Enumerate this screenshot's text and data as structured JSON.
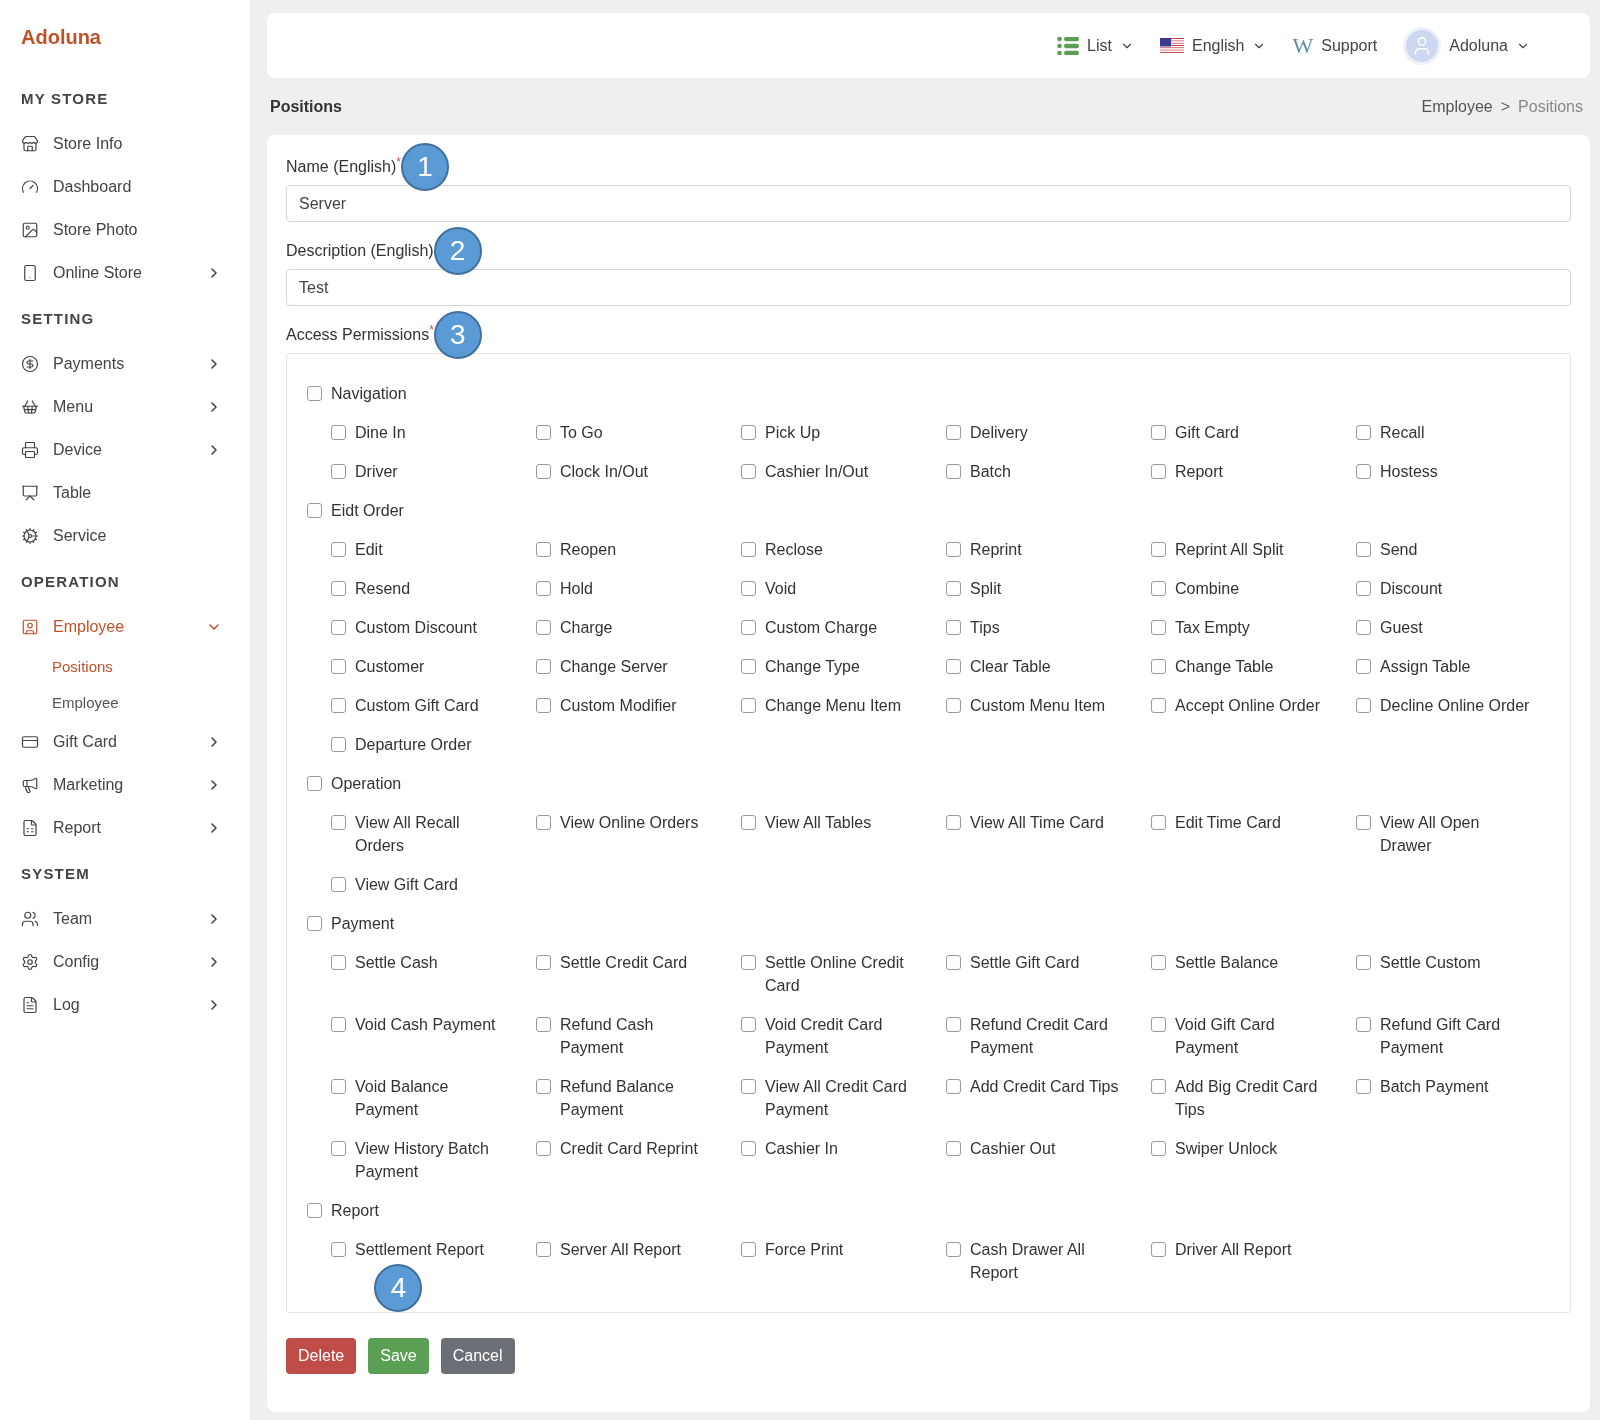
{
  "sidebar": {
    "brand": "Adoluna",
    "sections": [
      {
        "title": "MY STORE",
        "items": [
          {
            "label": "Store Info",
            "selected": false
          },
          {
            "label": "Dashboard",
            "selected": false
          },
          {
            "label": "Store Photo",
            "selected": false
          },
          {
            "label": "Online Store",
            "selected": false,
            "expanded": false
          }
        ]
      },
      {
        "title": "SETTING",
        "items": [
          {
            "label": "Payments",
            "selected": false,
            "expanded": false
          },
          {
            "label": "Menu",
            "selected": false,
            "expanded": false
          },
          {
            "label": "Device",
            "selected": false,
            "expanded": false
          },
          {
            "label": "Table",
            "selected": false
          },
          {
            "label": "Service",
            "selected": false
          }
        ]
      },
      {
        "title": "OPERATION",
        "items": [
          {
            "label": "Employee",
            "selected": true,
            "expanded": true,
            "children": [
              {
                "label": "Positions",
                "selected": true
              },
              {
                "label": "Employee",
                "selected": false
              }
            ]
          },
          {
            "label": "Gift Card",
            "selected": false,
            "expanded": false
          },
          {
            "label": "Marketing",
            "selected": false,
            "expanded": false
          },
          {
            "label": "Report",
            "selected": false,
            "expanded": false
          }
        ]
      },
      {
        "title": "SYSTEM",
        "items": [
          {
            "label": "Team",
            "selected": false,
            "expanded": false
          },
          {
            "label": "Config",
            "selected": false,
            "expanded": false
          },
          {
            "label": "Log",
            "selected": false,
            "expanded": false
          }
        ]
      }
    ]
  },
  "header": {
    "list": "List",
    "language": "English",
    "support_mark": "W",
    "support": "Support",
    "user": "Adoluna"
  },
  "page": {
    "title": "Positions",
    "breadcrumb": [
      "Employee",
      "Positions"
    ],
    "breadcrumb_separator": ">"
  },
  "form": {
    "fields": [
      {
        "label": "Name (English)",
        "required_mark": "*",
        "value": "Server",
        "callout": "1"
      },
      {
        "label": "Description (English)",
        "value": "Test",
        "callout": "2"
      }
    ],
    "permissions": {
      "label": "Access Permissions",
      "required_mark": "*",
      "callout": "3",
      "groups": [
        {
          "label": "Navigation",
          "checked": false,
          "children": [
            {
              "label": "Dine In",
              "checked": false
            },
            {
              "label": "To Go",
              "checked": false
            },
            {
              "label": "Pick Up",
              "checked": false
            },
            {
              "label": "Delivery",
              "checked": false
            },
            {
              "label": "Gift Card",
              "checked": false
            },
            {
              "label": "Recall",
              "checked": false
            },
            {
              "label": "Driver",
              "checked": false
            },
            {
              "label": "Clock In/Out",
              "checked": false
            },
            {
              "label": "Cashier In/Out",
              "checked": false
            },
            {
              "label": "Batch",
              "checked": false
            },
            {
              "label": "Report",
              "checked": false
            },
            {
              "label": "Hostess",
              "checked": false
            }
          ]
        },
        {
          "label": "Eidt Order",
          "checked": false,
          "children": [
            {
              "label": "Edit",
              "checked": false
            },
            {
              "label": "Reopen",
              "checked": false
            },
            {
              "label": "Reclose",
              "checked": false
            },
            {
              "label": "Reprint",
              "checked": false
            },
            {
              "label": "Reprint All Split",
              "checked": false
            },
            {
              "label": "Send",
              "checked": false
            },
            {
              "label": "Resend",
              "checked": false
            },
            {
              "label": "Hold",
              "checked": false
            },
            {
              "label": "Void",
              "checked": false
            },
            {
              "label": "Split",
              "checked": false
            },
            {
              "label": "Combine",
              "checked": false
            },
            {
              "label": "Discount",
              "checked": false
            },
            {
              "label": "Custom Discount",
              "checked": false
            },
            {
              "label": "Charge",
              "checked": false
            },
            {
              "label": "Custom Charge",
              "checked": false
            },
            {
              "label": "Tips",
              "checked": false
            },
            {
              "label": "Tax Empty",
              "checked": false
            },
            {
              "label": "Guest",
              "checked": false
            },
            {
              "label": "Customer",
              "checked": false
            },
            {
              "label": "Change Server",
              "checked": false
            },
            {
              "label": "Change Type",
              "checked": false
            },
            {
              "label": "Clear Table",
              "checked": false
            },
            {
              "label": "Change Table",
              "checked": false
            },
            {
              "label": "Assign Table",
              "checked": false
            },
            {
              "label": "Custom Gift Card",
              "checked": false
            },
            {
              "label": "Custom Modifier",
              "checked": false
            },
            {
              "label": "Change Menu Item",
              "checked": false
            },
            {
              "label": "Custom Menu Item",
              "checked": false
            },
            {
              "label": "Accept Online Order",
              "checked": false
            },
            {
              "label": "Decline Online Order",
              "checked": false
            },
            {
              "label": "Departure Order",
              "checked": false
            }
          ]
        },
        {
          "label": "Operation",
          "checked": false,
          "children": [
            {
              "label": "View All Recall Orders",
              "checked": false
            },
            {
              "label": "View Online Orders",
              "checked": false
            },
            {
              "label": "View All Tables",
              "checked": false
            },
            {
              "label": "View All Time Card",
              "checked": false
            },
            {
              "label": "Edit Time Card",
              "checked": false
            },
            {
              "label": "View All Open Drawer",
              "checked": false
            },
            {
              "label": "View Gift Card",
              "checked": false
            }
          ]
        },
        {
          "label": "Payment",
          "checked": false,
          "children": [
            {
              "label": "Settle Cash",
              "checked": false
            },
            {
              "label": "Settle Credit Card",
              "checked": false
            },
            {
              "label": "Settle Online Credit Card",
              "checked": false
            },
            {
              "label": "Settle Gift Card",
              "checked": false
            },
            {
              "label": "Settle Balance",
              "checked": false
            },
            {
              "label": "Settle Custom",
              "checked": false
            },
            {
              "label": "Void Cash Payment",
              "checked": false
            },
            {
              "label": "Refund Cash Payment",
              "checked": false
            },
            {
              "label": "Void Credit Card Payment",
              "checked": false
            },
            {
              "label": "Refund Credit Card Payment",
              "checked": false
            },
            {
              "label": "Void Gift Card Payment",
              "checked": false
            },
            {
              "label": "Refund Gift Card Payment",
              "checked": false
            },
            {
              "label": "Void Balance Payment",
              "checked": false
            },
            {
              "label": "Refund Balance Payment",
              "checked": false
            },
            {
              "label": "View All Credit Card Payment",
              "checked": false
            },
            {
              "label": "Add Credit Card Tips",
              "checked": false
            },
            {
              "label": "Add Big Credit Card Tips",
              "checked": false
            },
            {
              "label": "Batch Payment",
              "checked": false
            },
            {
              "label": "View History Batch Payment",
              "checked": false
            },
            {
              "label": "Credit Card Reprint",
              "checked": false
            },
            {
              "label": "Cashier In",
              "checked": false
            },
            {
              "label": "Cashier Out",
              "checked": false
            },
            {
              "label": "Swiper Unlock",
              "checked": false
            }
          ]
        },
        {
          "label": "Report",
          "checked": false,
          "children": [
            {
              "label": "Settlement Report",
              "checked": false
            },
            {
              "label": "Server All Report",
              "checked": false
            },
            {
              "label": "Force Print",
              "checked": false
            },
            {
              "label": "Cash Drawer All Report",
              "checked": false
            },
            {
              "label": "Driver All Report",
              "checked": false
            }
          ]
        }
      ]
    },
    "buttons": [
      {
        "label": "Delete",
        "kind": "danger"
      },
      {
        "label": "Save",
        "kind": "success",
        "callout": "4"
      },
      {
        "label": "Cancel",
        "kind": "secondary"
      }
    ]
  }
}
